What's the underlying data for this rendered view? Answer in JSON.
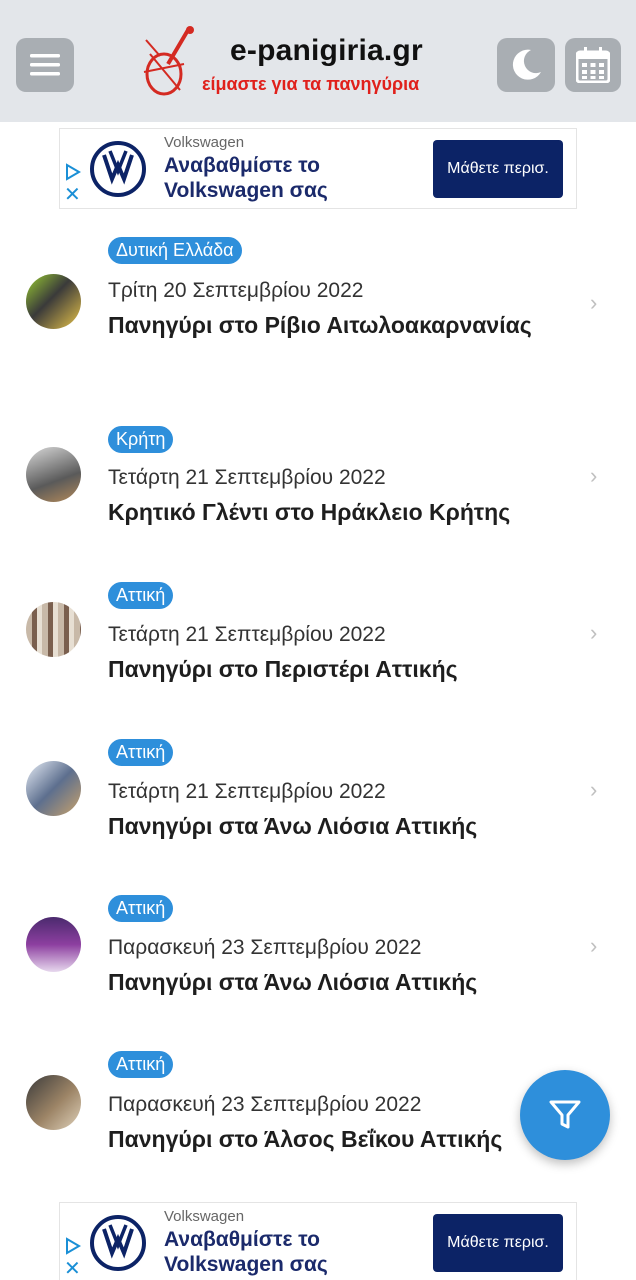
{
  "header": {
    "site_name": "e-panigiria.gr",
    "tagline": "είμαστε για τα πανηγύρια",
    "menu_icon": "hamburger-icon",
    "theme_icon": "moon-icon",
    "calendar_icon": "calendar-icon",
    "background": "#e3e6ea"
  },
  "ads": [
    {
      "brand": "Volkswagen",
      "text": "Αναβαθμίστε το Volkswagen σας",
      "cta": "Μάθετε περισ."
    },
    {
      "brand": "Volkswagen",
      "text": "Αναβαθμίστε το Volkswagen σας",
      "cta": "Μάθετε περισ."
    }
  ],
  "events": [
    {
      "region": "Δυτική Ελλάδα",
      "date": "Τρίτη 20 Σεπτεμβρίου 2022",
      "title": "Πανηγύρι στο Ρίβιο Αιτωλοακαρνανίας"
    },
    {
      "region": "Κρήτη",
      "date": "Τετάρτη 21 Σεπτεμβρίου 2022",
      "title": "Κρητικό Γλέντι στο Ηράκλειο Κρήτης"
    },
    {
      "region": "Αττική",
      "date": "Τετάρτη 21 Σεπτεμβρίου 2022",
      "title": "Πανηγύρι στο Περιστέρι Αττικής"
    },
    {
      "region": "Αττική",
      "date": "Τετάρτη 21 Σεπτεμβρίου 2022",
      "title": "Πανηγύρι στα Άνω Λιόσια Αττικής"
    },
    {
      "region": "Αττική",
      "date": "Παρασκευή 23 Σεπτεμβρίου 2022",
      "title": "Πανηγύρι στα Άνω Λιόσια Αττικής"
    },
    {
      "region": "Αττική",
      "date": "Παρασκευή 23 Σεπτεμβρίου 2022",
      "title": "Πανηγύρι στο Άλσος Βεΐκου Αττικής"
    }
  ],
  "fab": {
    "icon": "filter-icon",
    "color": "#2e8fdb"
  },
  "colors": {
    "accent": "#2e8fdb",
    "tagline": "#e0201b",
    "ad_cta": "#0c2366"
  }
}
